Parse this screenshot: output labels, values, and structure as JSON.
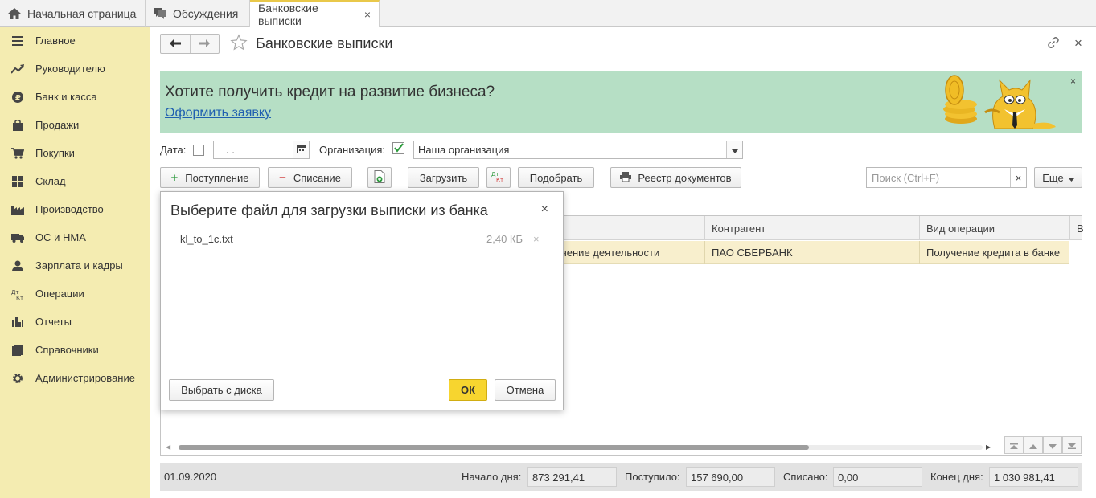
{
  "tabs": [
    {
      "label": "Начальная страница",
      "icon": "home-icon"
    },
    {
      "label": "Обсуждения",
      "icon": "chat-icon"
    },
    {
      "label": "Банковские выписки",
      "icon": "",
      "close": "×"
    }
  ],
  "sidebar": {
    "items": [
      {
        "label": "Главное",
        "icon": "menu-icon"
      },
      {
        "label": "Руководителю",
        "icon": "trend-icon"
      },
      {
        "label": "Банк и касса",
        "icon": "ruble-icon"
      },
      {
        "label": "Продажи",
        "icon": "bag-icon"
      },
      {
        "label": "Покупки",
        "icon": "cart-icon"
      },
      {
        "label": "Склад",
        "icon": "warehouse-icon"
      },
      {
        "label": "Производство",
        "icon": "factory-icon"
      },
      {
        "label": "ОС и НМА",
        "icon": "truck-icon"
      },
      {
        "label": "Зарплата и кадры",
        "icon": "person-icon"
      },
      {
        "label": "Операции",
        "icon": "dt-kt-icon"
      },
      {
        "label": "Отчеты",
        "icon": "bar-chart-icon"
      },
      {
        "label": "Справочники",
        "icon": "book-icon"
      },
      {
        "label": "Администрирование",
        "icon": "gear-icon"
      }
    ]
  },
  "page": {
    "title": "Банковские выписки"
  },
  "banner": {
    "title": "Хотите получить кредит на развитие бизнеса?",
    "link": "Оформить заявку",
    "close": "×"
  },
  "filters": {
    "date_label": "Дата:",
    "date_value": " .  .",
    "org_label": "Организация:",
    "org_value": "Наша организация"
  },
  "toolbar": {
    "receipt": "Поступление",
    "writeoff": "Списание",
    "load": "Загрузить",
    "dtkt": "Дт Кт",
    "select": "Подобрать",
    "registry": "Реестр документов",
    "search_placeholder": "Поиск (Ctrl+F)",
    "more": "Еще"
  },
  "table": {
    "columns": [
      "Контрагент",
      "Вид операции",
      "В"
    ],
    "rows": [
      {
        "purpose": "чение деятельности",
        "counterparty": "ПАО СБЕРБАНК",
        "operation": "Получение кредита в банке"
      }
    ]
  },
  "footer": {
    "date": "01.09.2020",
    "start_label": "Начало дня:",
    "start_value": "873 291,41",
    "in_label": "Поступило:",
    "in_value": "157 690,00",
    "out_label": "Списано:",
    "out_value": "0,00",
    "end_label": "Конец дня:",
    "end_value": "1 030 981,41"
  },
  "dialog": {
    "title": "Выберите файл для загрузки выписки из банка",
    "close": "×",
    "file_name": "kl_to_1c.txt",
    "file_size": "2,40 КБ",
    "file_remove": "×",
    "choose_btn": "Выбрать с диска",
    "ok_btn": "ОК",
    "cancel_btn": "Отмена"
  },
  "colors": {
    "sidebar_bg": "#f4ecb1",
    "banner_bg": "#b6dfc5",
    "row_selected": "#f8efcd",
    "ok_button": "#f7d52f",
    "link": "#1f5fb0"
  }
}
